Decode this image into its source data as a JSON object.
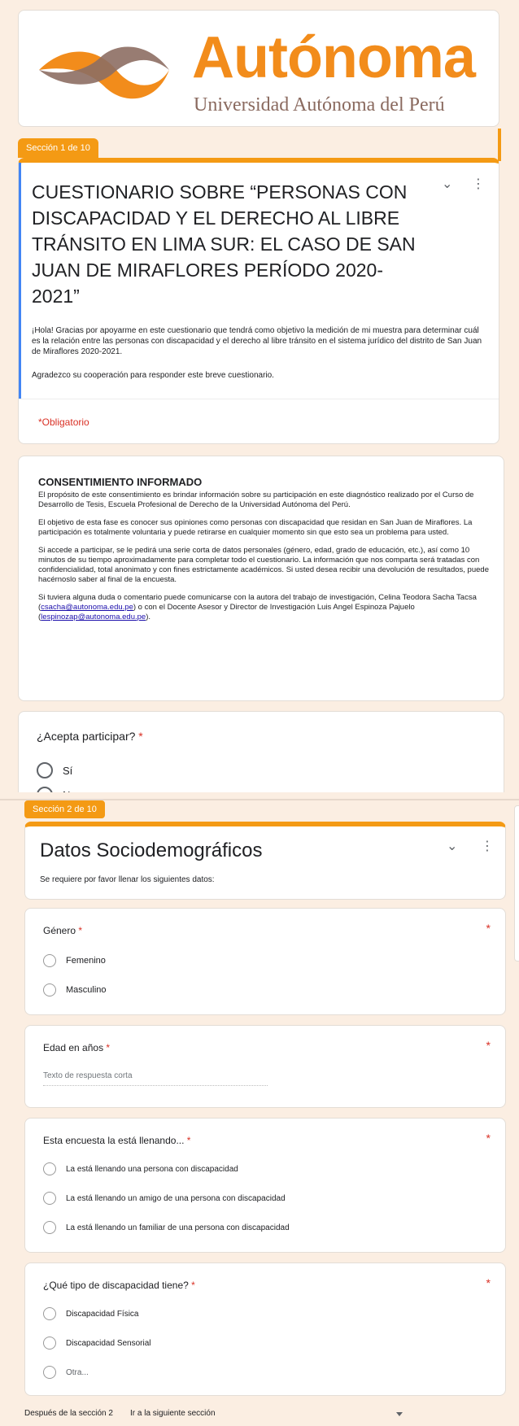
{
  "logo": {
    "wordmark": "Autónoma",
    "subtitle": "Universidad Autónoma del Perú",
    "brand_color": "#f28c1b",
    "subtitle_color": "#8a6a5f"
  },
  "section1": {
    "tab": "Sección 1 de 10",
    "title": "CUESTIONARIO SOBRE “PERSONAS CON DISCAPACIDAD Y EL DERECHO AL LIBRE TRÁNSITO EN LIMA SUR: EL CASO DE SAN JUAN DE MIRAFLORES PERÍODO 2020-2021”",
    "intro": "¡Hola! Gracias por apoyarme en este cuestionario que tendrá como objetivo la medición de mi muestra para determinar cuál es la relación entre las personas con discapacidad y el derecho al libre tránsito en el sistema jurídico del distrito de San Juan de Miraflores 2020-2021.",
    "thanks": "Agradezco su cooperación para responder este breve cuestionario.",
    "required_note": "*Obligatorio"
  },
  "consent": {
    "heading": "CONSENTIMIENTO INFORMADO",
    "p1": "El propósito de este consentimiento es brindar información sobre su participación en este diagnóstico realizado por el Curso de Desarrollo de Tesis, Escuela Profesional de Derecho de la Universidad Autónoma del Perú.",
    "p2": "El objetivo de esta fase es conocer sus opiniones como personas con discapacidad que residan en San Juan de Miraflores. La participación es totalmente voluntaria y puede retirarse en cualquier momento sin que esto sea un problema para usted.",
    "p3": "Si accede a participar, se le pedirá una serie corta de datos personales (género, edad, grado de educación, etc.), así como 10 minutos de su tiempo aproximadamente para completar todo el cuestionario. La información que nos comparta será tratadas con confidencialidad, total anonimato y con fines estrictamente académicos. Si usted desea recibir una devolución de resultados, puede hacérnoslo saber al final de la encuesta.",
    "p4_a": "Si tuviera alguna duda o comentario puede comunicarse con la autora del trabajo de investigación, Celina Teodora Sacha Tacsa (",
    "email1": "csacha@autonoma.edu.pe",
    "p4_b": ") o con el Docente Asesor y Director de Investigación Luis Angel Espinoza Pajuelo (",
    "email2": "lespinozap@autonoma.edu.pe",
    "p4_c": ")."
  },
  "q_accept": {
    "label": "¿Acepta participar?",
    "star": "*",
    "options": [
      "Sí",
      "No"
    ]
  },
  "section2": {
    "tab": "Sección 2 de 10",
    "title": "Datos Sociodemográficos",
    "description": "Se requiere por favor llenar los siguientes datos:"
  },
  "q_gender": {
    "label": "Género",
    "star": "*",
    "options": [
      "Femenino",
      "Masculino"
    ]
  },
  "q_age": {
    "label": "Edad en años",
    "star": "*",
    "placeholder": "Texto de respuesta corta"
  },
  "q_filler": {
    "label": "Esta encuesta la está llenando...",
    "star": "*",
    "options": [
      "La está llenando una persona con discapacidad",
      "La está llenando un amigo de una persona con discapacidad",
      "La está llenando un familiar de una persona con discapacidad"
    ]
  },
  "q_disability": {
    "label": "¿Qué tipo de discapacidad tiene?",
    "star": "*",
    "options": [
      "Discapacidad Física",
      "Discapacidad Sensorial",
      "Otra..."
    ]
  },
  "footer": {
    "after_section": "Después de la sección 2",
    "navigation": "Ir a la siguiente sección"
  },
  "icons": {
    "collapse": "⌄",
    "more": "⋮"
  },
  "colors": {
    "accent": "#f49a14",
    "required": "#d93025",
    "background": "#fbeee2"
  }
}
